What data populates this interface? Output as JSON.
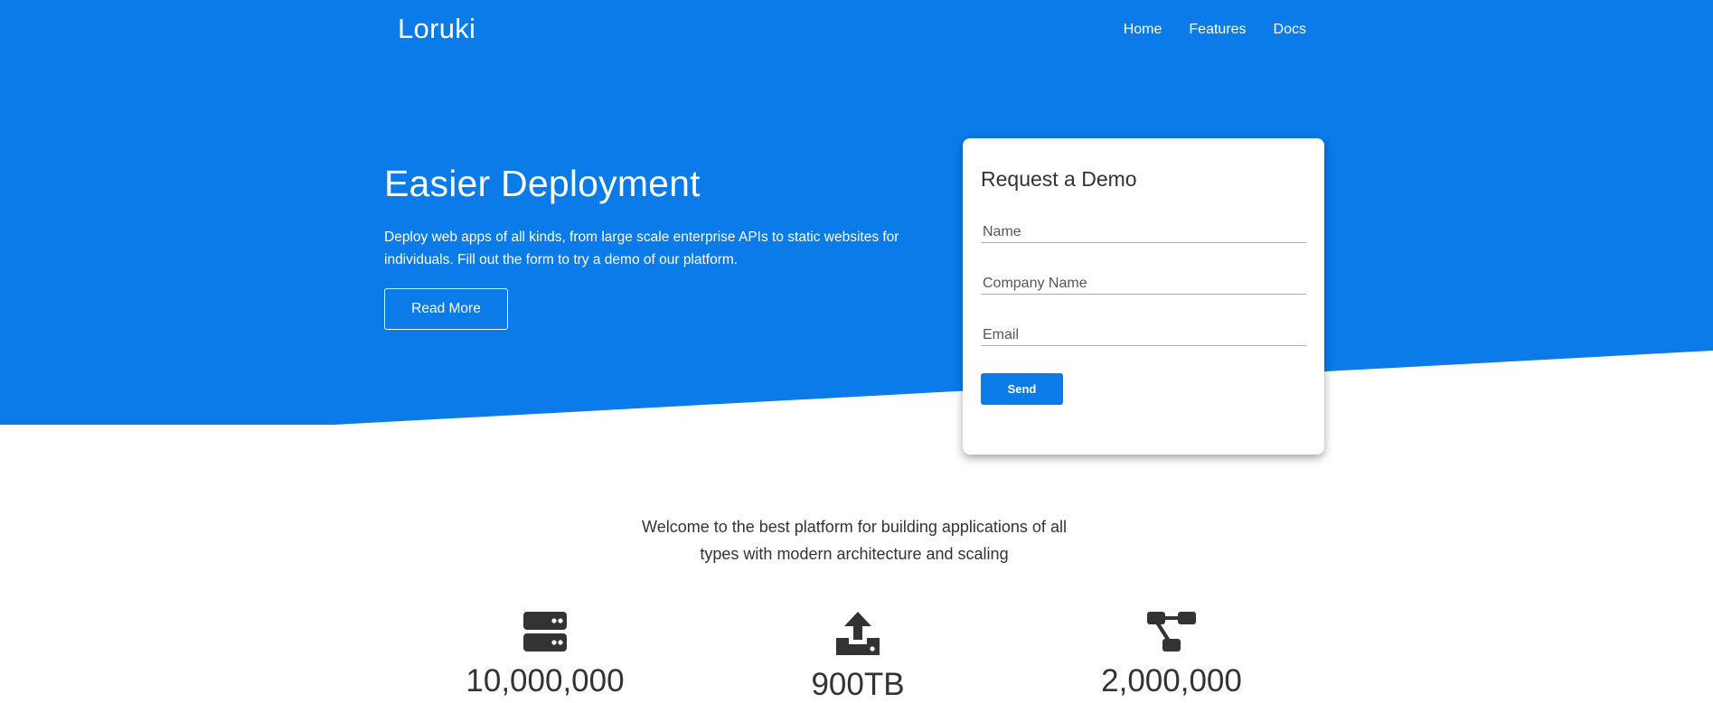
{
  "header": {
    "brand": "Loruki",
    "nav": [
      "Home",
      "Features",
      "Docs"
    ]
  },
  "hero": {
    "title": "Easier Deployment",
    "text": "Deploy web apps of all kinds, from large scale enterprise APIs to static websites for individuals. Fill out the form to try a demo of our platform.",
    "button": "Read More"
  },
  "demo_form": {
    "title": "Request a Demo",
    "fields": [
      {
        "placeholder": "Name",
        "value": ""
      },
      {
        "placeholder": "Company Name",
        "value": ""
      },
      {
        "placeholder": "Email",
        "value": ""
      }
    ],
    "submit": "Send"
  },
  "welcome_text": "Welcome to the best platform for building applications of all types with modern architecture and scaling",
  "stats": [
    {
      "icon": "server-icon",
      "value": "10,000,000"
    },
    {
      "icon": "upload-icon",
      "value": "900TB"
    },
    {
      "icon": "project-diagram-icon",
      "value": "2,000,000"
    }
  ],
  "colors": {
    "primary": "#0a7be9",
    "text": "#333333",
    "background": "#ffffff"
  }
}
